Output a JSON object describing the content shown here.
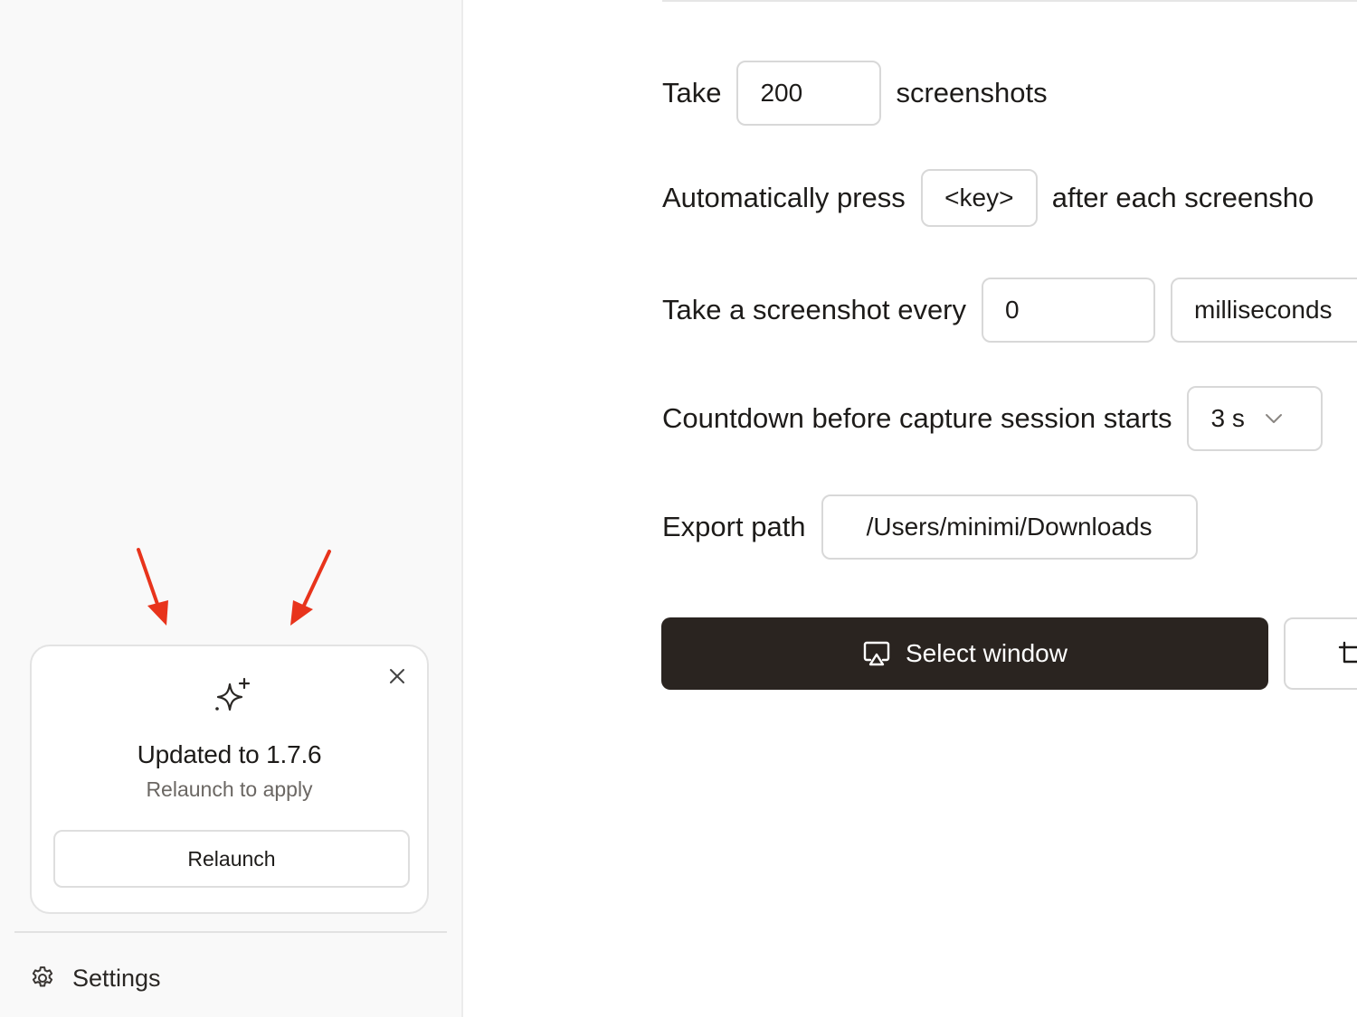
{
  "sidebar": {
    "update_card": {
      "title": "Updated to 1.7.6",
      "subtitle": "Relaunch to apply",
      "button_label": "Relaunch"
    },
    "settings_label": "Settings"
  },
  "main": {
    "count_row": {
      "prefix": "Take",
      "value": "200",
      "suffix": "screenshots"
    },
    "key_row": {
      "prefix": "Automatically press",
      "key": "<key>",
      "suffix": "after each screensho"
    },
    "interval_row": {
      "prefix": "Take a screenshot every",
      "value": "0",
      "unit": "milliseconds"
    },
    "countdown_row": {
      "label": "Countdown before capture session starts",
      "selected": "3 s"
    },
    "export_row": {
      "label": "Export path",
      "path": "/Users/minimi/Downloads"
    },
    "select_window_label": "Select window"
  },
  "colors": {
    "primary_button": "#2a2420",
    "annotation_arrow": "#e8341c",
    "sidebar_bg": "#f9f9f9"
  },
  "icons": {
    "sparkle": "sparkle-icon",
    "close": "close-icon",
    "settings": "gear-icon",
    "select_window": "airplay-screen-icon",
    "chevron": "chevron-down-icon",
    "crop": "crop-icon"
  }
}
